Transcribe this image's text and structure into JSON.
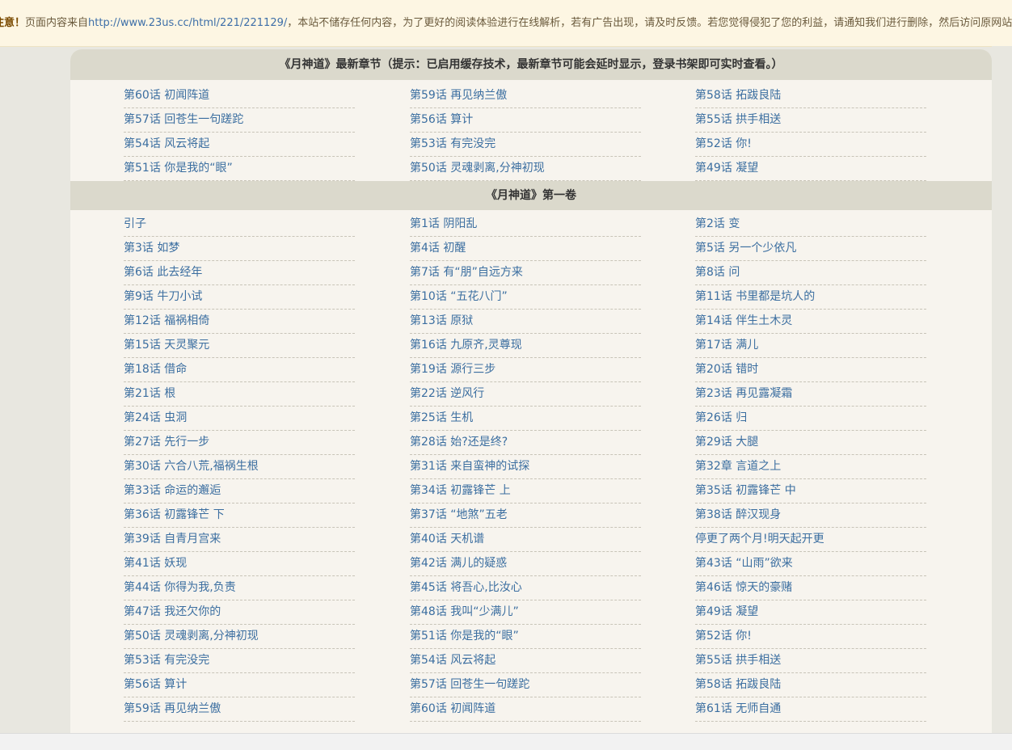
{
  "notice": {
    "label": "注意！",
    "prefix": "页面内容来自",
    "url": "http://www.23us.cc/html/221/221129/",
    "suffix": "，本站不储存任何内容，为了更好的阅读体验进行在线解析，若有广告出现，请及时反馈。若您觉得侵犯了您的利益，请通知我们进行删除，然后访问原网站"
  },
  "latest": {
    "title": "《月神道》最新章节（提示：已启用缓存技术，最新章节可能会延时显示，登录书架即可实时查看。）",
    "chapters": [
      "第60话 初闻阵道",
      "第59话 再见纳兰傲",
      "第58话 拓跋良陆",
      "第57话 回苍生一句蹉跎",
      "第56话 算计",
      "第55话 拱手相送",
      "第54话 风云将起",
      "第53话 有完没完",
      "第52话 你!",
      "第51话 你是我的“眼”",
      "第50话 灵魂剥离,分神初现",
      "第49话 凝望"
    ]
  },
  "volume": {
    "title": "《月神道》第一卷",
    "chapters": [
      "引子",
      "第1话 阴阳乱",
      "第2话 变",
      "第3话 如梦",
      "第4话 初醒",
      "第5话 另一个少依凡",
      "第6话 此去经年",
      "第7话 有“朋”自远方来",
      "第8话 问",
      "第9话 牛刀小试",
      "第10话 “五花八门”",
      "第11话 书里都是坑人的",
      "第12话 福祸相倚",
      "第13话 原狱",
      "第14话 伴生土木灵",
      "第15话 天灵聚元",
      "第16话 九原齐,灵尊现",
      "第17话 满儿",
      "第18话 借命",
      "第19话 源行三步",
      "第20话 错时",
      "第21话 根",
      "第22话 逆风行",
      "第23话 再见露凝霜",
      "第24话 虫洞",
      "第25话 生机",
      "第26话 归",
      "第27话 先行一步",
      "第28话 始?还是终?",
      "第29话 大腿",
      "第30话 六合八荒,福祸生根",
      "第31话 来自蛮神的试探",
      "第32章 言道之上",
      "第33话 命运的邂逅",
      "第34话 初露锋芒 上",
      "第35话 初露锋芒 中",
      "第36话 初露锋芒 下",
      "第37话 “地煞”五老",
      "第38话 醉汉现身",
      "第39话 自青月宫来",
      "第40话 天机谱",
      "停更了两个月!明天起开更",
      "第41话 妖现",
      "第42话 满儿的疑惑",
      "第43话 “山雨”欲来",
      "第44话 你得为我,负责",
      "第45话 将吾心,比汝心",
      "第46话 惊天的豪赌",
      "第47话 我还欠你的",
      "第48话 我叫“少满儿”",
      "第49话 凝望",
      "第50话 灵魂剥离,分神初现",
      "第51话 你是我的“眼”",
      "第52话 你!",
      "第53话 有完没完",
      "第54话 风云将起",
      "第55话 拱手相送",
      "第56话 算计",
      "第57话 回苍生一句蹉跎",
      "第58话 拓跋良陆",
      "第59话 再见纳兰傲",
      "第60话 初闻阵道",
      "第61话 无师自通"
    ]
  },
  "colors": {
    "link": "#3b6ea0",
    "panel_bg": "#f7f4ee",
    "header_bg": "#dbd9cc",
    "notice_bg": "#fdf6e3"
  }
}
